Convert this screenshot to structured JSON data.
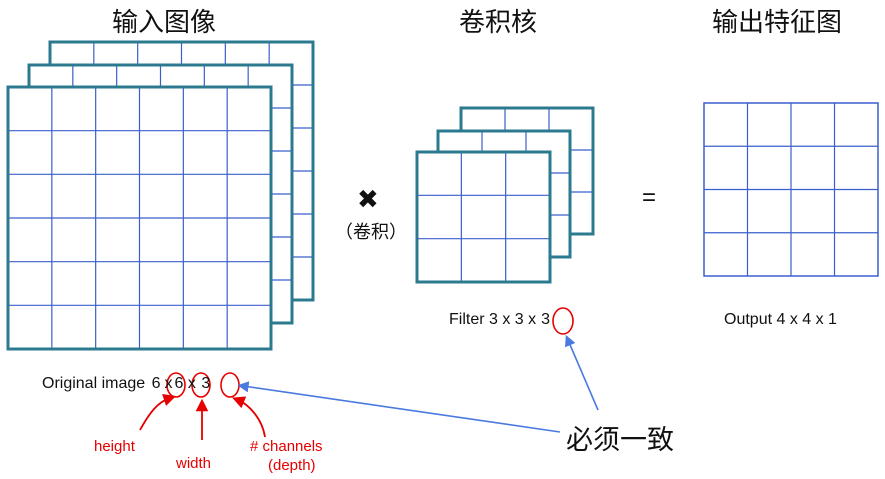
{
  "titles": {
    "input": "输入图像",
    "kernel": "卷积核",
    "output": "输出特征图"
  },
  "operators": {
    "times_symbol": "✖",
    "conv_label": "（卷积）",
    "equals": "="
  },
  "captions": {
    "input_prefix": "Original image",
    "input_h": "6",
    "input_x1": "x",
    "input_w": "6",
    "input_x2": "x",
    "input_c": "3",
    "filter_prefix": "Filter 3 x 3 x",
    "filter_c": "3",
    "output": "Output 4 x 4 x 1"
  },
  "annotations": {
    "height": "height",
    "width": "width",
    "channels_1": "# channels",
    "channels_2": "(depth)",
    "must_match": "必须一致"
  },
  "grids": {
    "input": {
      "rows": 6,
      "cols": 6,
      "layers": 3
    },
    "filter": {
      "rows": 3,
      "cols": 3,
      "layers": 3
    },
    "output": {
      "rows": 4,
      "cols": 4,
      "layers": 1
    }
  },
  "colors": {
    "grid_line": "#3a5fcd",
    "layer_border": "#2b7a8f",
    "annotation_red": "#e60000",
    "arrow_blue": "#4a7ae0"
  }
}
